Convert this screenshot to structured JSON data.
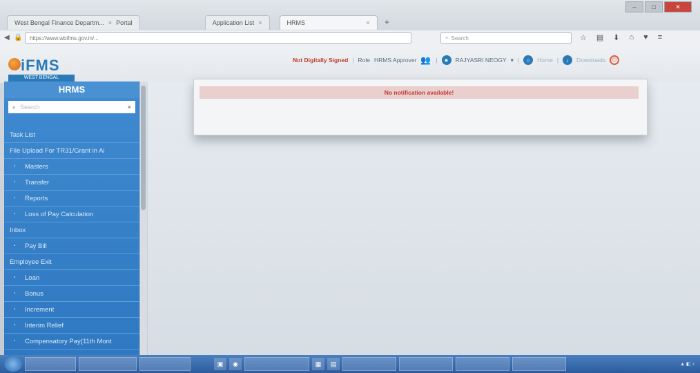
{
  "browser": {
    "tabs": [
      {
        "label": "West Bengal Finance Departm...",
        "extra": "Portal"
      },
      {
        "label": "Application List"
      },
      {
        "label": "HRMS"
      }
    ],
    "url": "https://www.wbifms.gov.in/...",
    "search_placeholder": "Search"
  },
  "header": {
    "logo": "iFMS",
    "logo_sub": "WEST BENGAL",
    "sign_status": "Not Digitally Signed",
    "role_label": "Role",
    "role_value": "HRMS Approver",
    "user_name": "RAJYASRI NEOGY",
    "home_label": "Home",
    "downloads_label": "Downloads"
  },
  "sidebar": {
    "title": "HRMS",
    "search_placeholder": "Search",
    "items": [
      {
        "label": "Task List",
        "level": "top"
      },
      {
        "label": "File Upload For TR31/Grant in Ai",
        "level": "top"
      },
      {
        "label": "Masters",
        "level": "sub"
      },
      {
        "label": "Transfer",
        "level": "sub"
      },
      {
        "label": "Reports",
        "level": "sub"
      },
      {
        "label": "Loss of Pay Calculation",
        "level": "sub"
      },
      {
        "label": "Inbox",
        "level": "top"
      },
      {
        "label": "Pay Bill",
        "level": "sub"
      },
      {
        "label": "Employee Exit",
        "level": "top"
      },
      {
        "label": "Loan",
        "level": "sub"
      },
      {
        "label": "Bonus",
        "level": "sub"
      },
      {
        "label": "Increment",
        "level": "sub"
      },
      {
        "label": "Interim Relief",
        "level": "sub"
      },
      {
        "label": "Compensatory Pay(11th Mont",
        "level": "sub"
      }
    ]
  },
  "notification": {
    "message": "No notification available!"
  },
  "colors": {
    "sidebar": "#3a85cc",
    "accent": "#2a7ab8",
    "alert": "#c0392b"
  }
}
